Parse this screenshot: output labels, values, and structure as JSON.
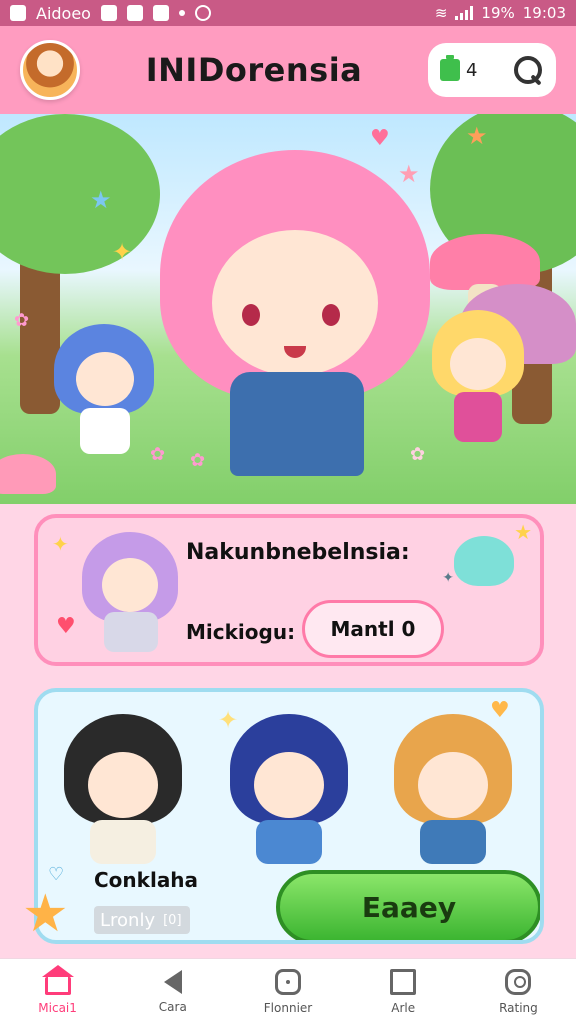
{
  "status_bar": {
    "app": "Aidoeo",
    "battery": "19%",
    "time": "19:03"
  },
  "header": {
    "title": "INIDorensia",
    "count": "4"
  },
  "card1": {
    "name": "Nakunbnebelnsia:",
    "subtitle": "Mickiogu:",
    "button": "Mantl 0"
  },
  "card2": {
    "label": "Conklaha",
    "pill": "Lronly",
    "pill_icon": "[0]",
    "button": "Eaaey"
  },
  "bottom_nav": {
    "items": [
      {
        "label": "Micai1",
        "icon": "home-icon"
      },
      {
        "label": "Cara",
        "icon": "back-icon"
      },
      {
        "label": "Flonnier",
        "icon": "circle-icon"
      },
      {
        "label": "Arle",
        "icon": "square-icon"
      },
      {
        "label": "Rating",
        "icon": "person-icon"
      }
    ]
  },
  "colors": {
    "status": "#c95a86",
    "header": "#ff9cc0",
    "accent": "#ff3c7a",
    "green_button": "#3cb531"
  }
}
